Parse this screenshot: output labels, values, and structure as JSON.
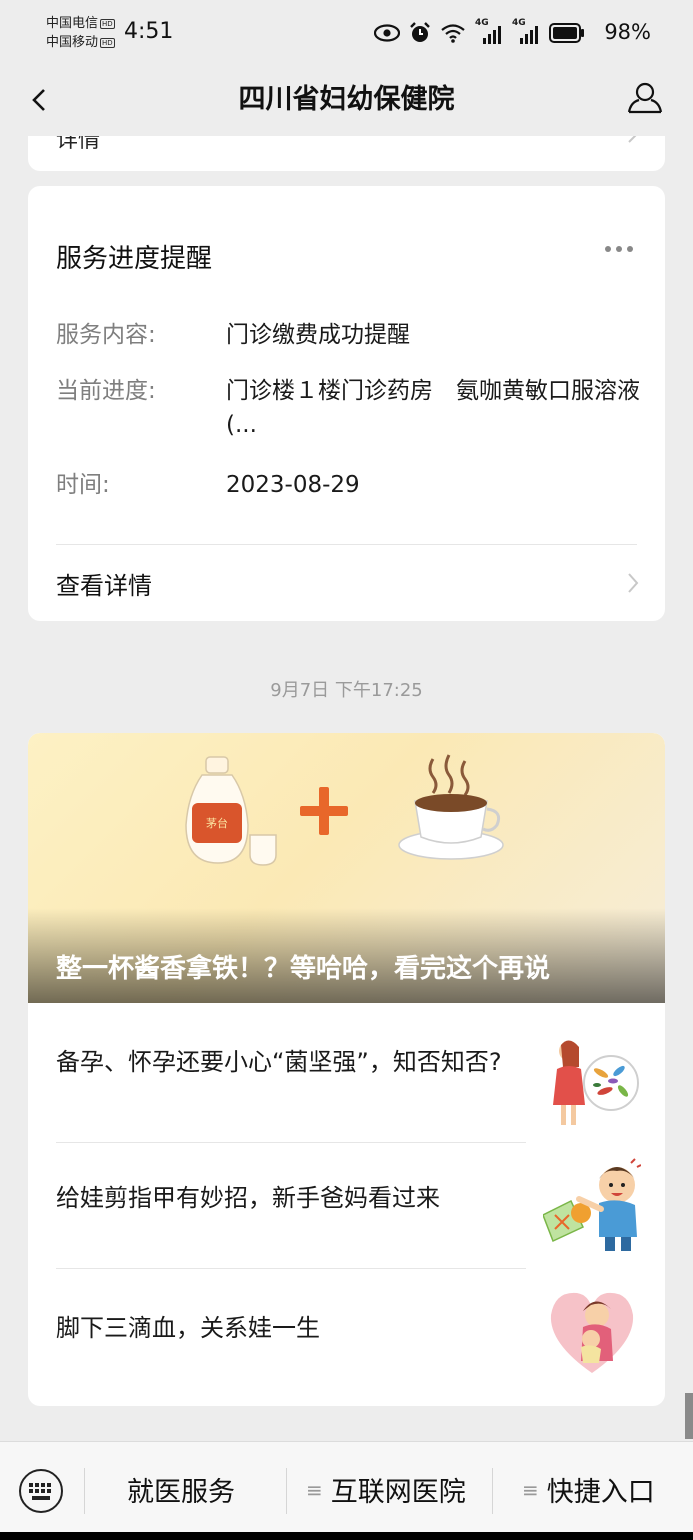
{
  "status_bar": {
    "carrier_1": "中国电信",
    "carrier_2": "中国移动",
    "hd_badge": "HD",
    "time": "4:51",
    "battery": "98%",
    "net_1": "4G",
    "net_2": "4G"
  },
  "nav": {
    "title": "四川省妇幼保健院"
  },
  "prev_card": {
    "label": "详情"
  },
  "service_card": {
    "title": "服务进度提醒",
    "rows": [
      {
        "key": "服务内容:",
        "value": "门诊缴费成功提醒"
      },
      {
        "key": "当前进度:",
        "value": "门诊楼１楼门诊药房　氨咖黄敏口服溶液(..."
      },
      {
        "key": "时间:",
        "value": "2023-08-29"
      }
    ],
    "detail_link": "查看详情"
  },
  "timestamp": "9月7日 下午17:25",
  "articles": {
    "cover_title": "整一杯酱香拿铁！？等哈哈，看完这个再说",
    "cover_bottle_label": "茅台",
    "items": [
      {
        "title": "备孕、怀孕还要小心“菌坚强”，知否知否?"
      },
      {
        "title": "给娃剪指甲有妙招，新手爸妈看过来"
      },
      {
        "title": "脚下三滴血，关系娃一生"
      }
    ]
  },
  "bottom_menu": {
    "items": [
      "就医服务",
      "互联网医院",
      "快捷入口"
    ]
  },
  "colors": {
    "background": "#ededed",
    "card": "#ffffff",
    "secondary_text": "#7f7f7f",
    "cover_accent": "#e8672a"
  }
}
